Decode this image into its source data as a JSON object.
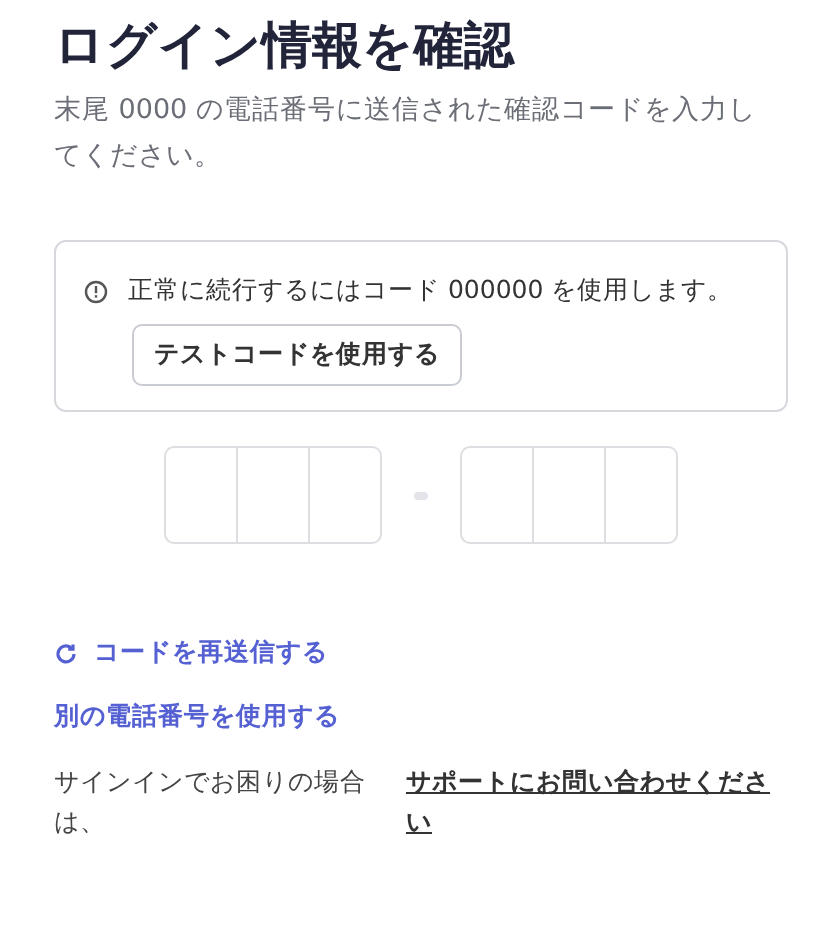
{
  "title": "ログイン情報を確認",
  "subtitle": "末尾 0000 の電話番号に送信された確認コードを入力してください。",
  "notice": {
    "text": "正常に続行するにはコード 000000 を使用します。",
    "button": "テストコードを使用する"
  },
  "code_groups": [
    {
      "cells": [
        {
          "kind": "digit"
        },
        {
          "kind": "digit"
        },
        {
          "kind": "digit"
        }
      ]
    },
    {
      "cells": [
        {
          "kind": "digit"
        },
        {
          "kind": "digit"
        },
        {
          "kind": "digit"
        }
      ]
    }
  ],
  "links": [
    {
      "kind": "resend",
      "label": "コードを再送信する"
    },
    {
      "kind": "plain",
      "label": "別の電話番号を使用する"
    }
  ],
  "help": {
    "text": "サインインでお困りの場合は、",
    "link": "サポートにお問い合わせください"
  }
}
